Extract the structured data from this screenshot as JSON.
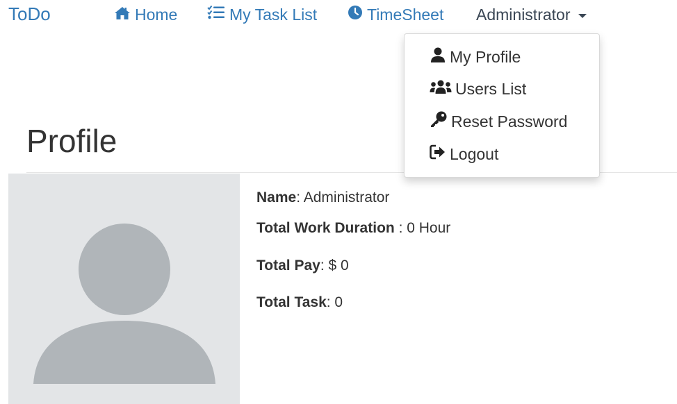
{
  "navbar": {
    "brand": "ToDo",
    "home": "Home",
    "task_list": "My Task List",
    "timesheet": "TimeSheet",
    "user_menu": "Administrator"
  },
  "dropdown": {
    "items": [
      {
        "label": "My Profile",
        "icon": "user-icon"
      },
      {
        "label": "Users List",
        "icon": "users-icon"
      },
      {
        "label": "Reset Password",
        "icon": "key-icon"
      },
      {
        "label": "Logout",
        "icon": "logout-icon"
      }
    ]
  },
  "page": {
    "title": "Profile"
  },
  "profile": {
    "name_label": "Name",
    "name_sep": ": ",
    "name_value": "Administrator",
    "duration_label": "Total Work Duration",
    "duration_sep": " : ",
    "duration_value": "0 Hour",
    "pay_label": "Total Pay",
    "pay_sep": ": ",
    "pay_value": "$ 0",
    "task_label": "Total Task",
    "task_sep": ": ",
    "task_value": "0"
  },
  "colors": {
    "link": "#337ab7",
    "avatar_bg": "#e3e5e7",
    "avatar_fg": "#b0b5b9"
  }
}
